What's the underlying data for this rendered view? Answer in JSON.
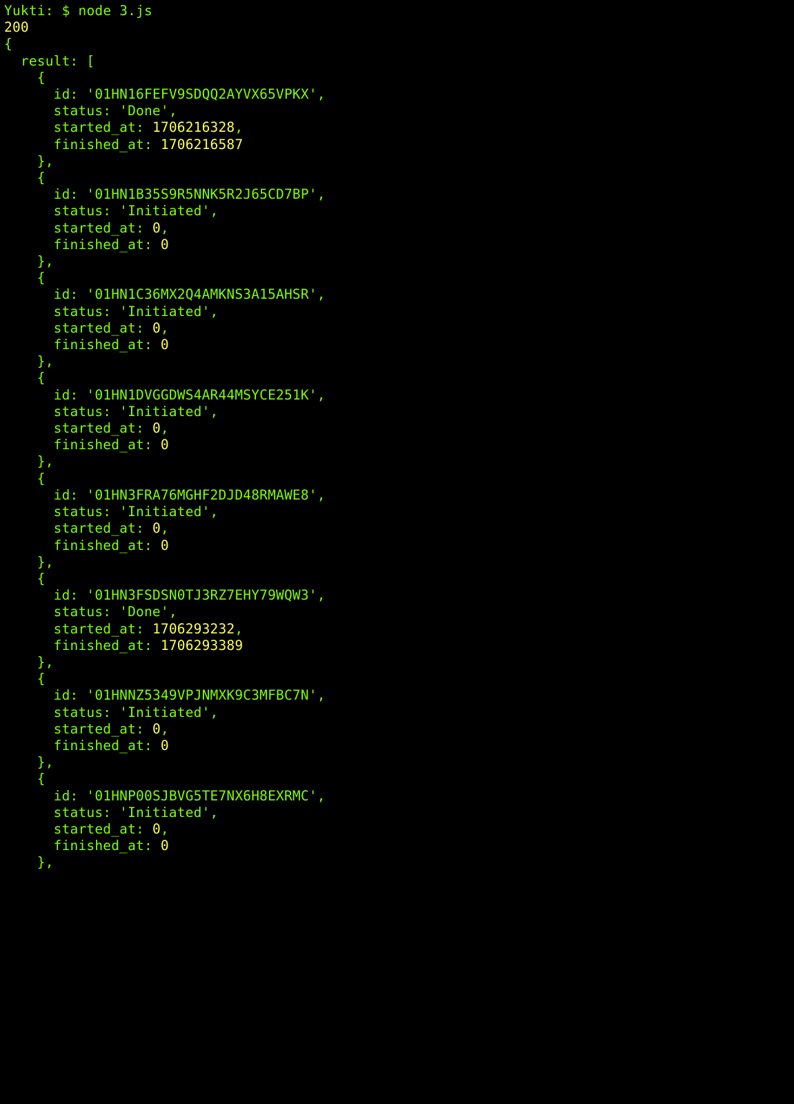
{
  "prompt": {
    "host": "Yukti:",
    "symbol": "$",
    "command": "node 3.js"
  },
  "status_code": "200",
  "root_key": "result",
  "fields": {
    "id": "id",
    "status": "status",
    "started_at": "started_at",
    "finished_at": "finished_at"
  },
  "items": [
    {
      "id": "01HN16FEFV9SDQQ2AYVX65VPKX",
      "status": "Done",
      "started_at": "1706216328",
      "finished_at": "1706216587"
    },
    {
      "id": "01HN1B35S9R5NNK5R2J65CD7BP",
      "status": "Initiated",
      "started_at": "0",
      "finished_at": "0"
    },
    {
      "id": "01HN1C36MX2Q4AMKNS3A15AHSR",
      "status": "Initiated",
      "started_at": "0",
      "finished_at": "0"
    },
    {
      "id": "01HN1DVGGDWS4AR44MSYCE251K",
      "status": "Initiated",
      "started_at": "0",
      "finished_at": "0"
    },
    {
      "id": "01HN3FRA76MGHF2DJD48RMAWE8",
      "status": "Initiated",
      "started_at": "0",
      "finished_at": "0"
    },
    {
      "id": "01HN3FSDSN0TJ3RZ7EHY79WQW3",
      "status": "Done",
      "started_at": "1706293232",
      "finished_at": "1706293389"
    },
    {
      "id": "01HNNZ5349VPJNMXK9C3MFBC7N",
      "status": "Initiated",
      "started_at": "0",
      "finished_at": "0"
    },
    {
      "id": "01HNP00SJBVG5TE7NX6H8EXRMC",
      "status": "Initiated",
      "started_at": "0",
      "finished_at": "0"
    }
  ]
}
